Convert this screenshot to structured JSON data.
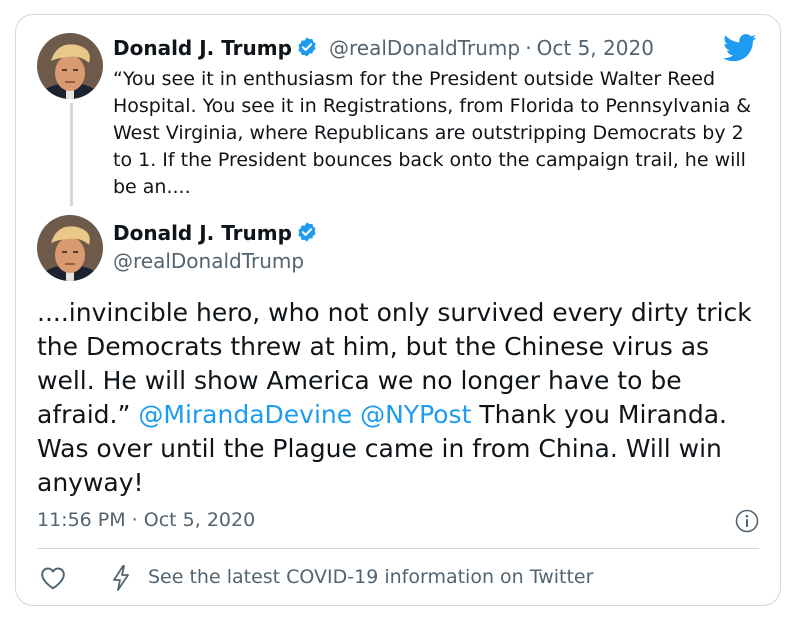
{
  "colors": {
    "accent": "#1d9bf0",
    "text": "#0f1419",
    "muted": "#536471",
    "border": "#cfd9de"
  },
  "quoted_tweet": {
    "author_name": "Donald J. Trump",
    "handle": "@realDonaldTrump",
    "separator": "·",
    "date": "Oct 5, 2020",
    "text": "“You see it in enthusiasm for the President outside Walter Reed Hospital. You see it in Registrations, from Florida to Pennsylvania & West Virginia, where Republicans are outstripping Democrats by 2 to 1. If the President bounces back onto the campaign trail, he will be an...."
  },
  "main_tweet": {
    "author_name": "Donald J. Trump",
    "handle": "@realDonaldTrump",
    "text_part1": "....invincible hero, who not only survived every dirty trick the Democrats threw at him, but the Chinese virus as well. He will show America we no longer have to be afraid.” ",
    "mention1": "@MirandaDevine",
    "space": " ",
    "mention2": "@NYPost",
    "text_part2": "  Thank you Miranda. Was over until the Plague came in from China. Will win anyway!",
    "timestamp": "11:56 PM · Oct 5, 2020"
  },
  "footer": {
    "covid_link": "See the latest COVID-19 information on Twitter"
  },
  "icons": [
    "verified-badge-icon",
    "twitter-bird-icon",
    "info-icon",
    "heart-icon",
    "lightning-bolt-icon",
    "avatar"
  ]
}
